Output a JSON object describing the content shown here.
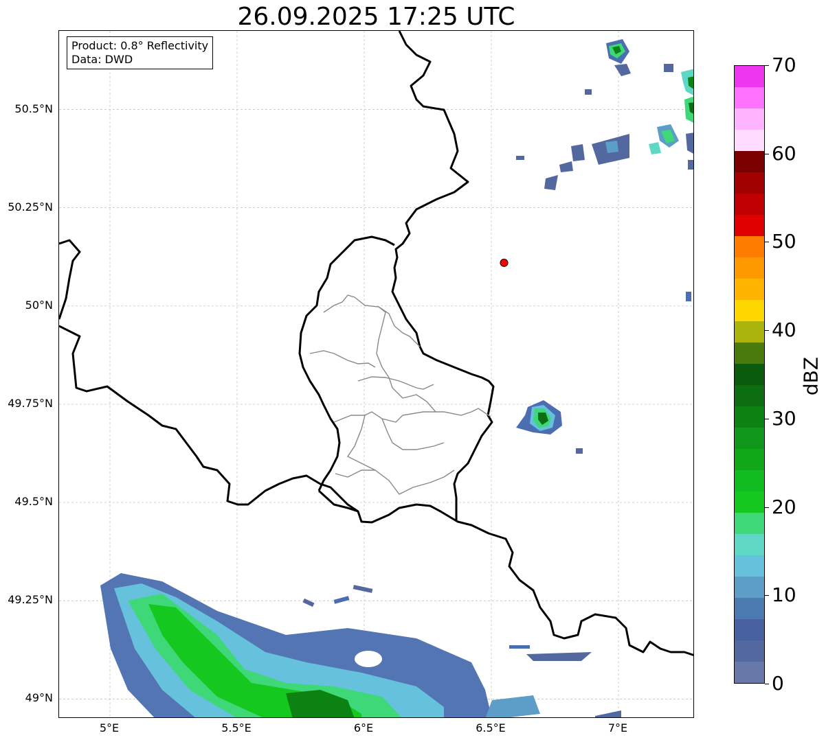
{
  "title": "26.09.2025 17:25 UTC",
  "info": {
    "product": "Product: 0.8° Reflectivity",
    "data": "Data: DWD"
  },
  "map": {
    "lon_range": [
      4.8,
      7.3
    ],
    "lat_range": [
      48.95,
      50.7
    ],
    "lat_ticks": [
      {
        "value": 50.5,
        "label": "50.5°N"
      },
      {
        "value": 50.25,
        "label": "50.25°N"
      },
      {
        "value": 50.0,
        "label": "50°N"
      },
      {
        "value": 49.75,
        "label": "49.75°N"
      },
      {
        "value": 49.5,
        "label": "49.5°N"
      },
      {
        "value": 49.25,
        "label": "49.25°N"
      },
      {
        "value": 49.0,
        "label": "49°N"
      }
    ],
    "lon_ticks": [
      {
        "value": 5.0,
        "label": "5°E"
      },
      {
        "value": 5.5,
        "label": "5.5°E"
      },
      {
        "value": 6.0,
        "label": "6°E"
      },
      {
        "value": 6.5,
        "label": "6.5°E"
      },
      {
        "value": 7.0,
        "label": "7°E"
      }
    ],
    "marker": {
      "lon": 6.55,
      "lat": 50.11,
      "color": "#ff0000"
    }
  },
  "colorbar": {
    "label": "dBZ",
    "min": 0,
    "max": 70,
    "ticks": [
      "0",
      "10",
      "20",
      "30",
      "40",
      "50",
      "60",
      "70"
    ],
    "colors": [
      "#6878a8",
      "#5468a0",
      "#4660a0",
      "#4a7ab0",
      "#5c9ec8",
      "#66c2dc",
      "#5ed8c4",
      "#3ed878",
      "#14c820",
      "#10bc20",
      "#10a818",
      "#10961a",
      "#0c8212",
      "#0c6e10",
      "#0a5c0c",
      "#4a7a0c",
      "#aab40c",
      "#fed600",
      "#feb400",
      "#fe9a00",
      "#fe7c00",
      "#e00000",
      "#c00000",
      "#a00000",
      "#7a0000",
      "#ffdcff",
      "#ffb4ff",
      "#ff72ff",
      "#ee36ee"
    ]
  }
}
